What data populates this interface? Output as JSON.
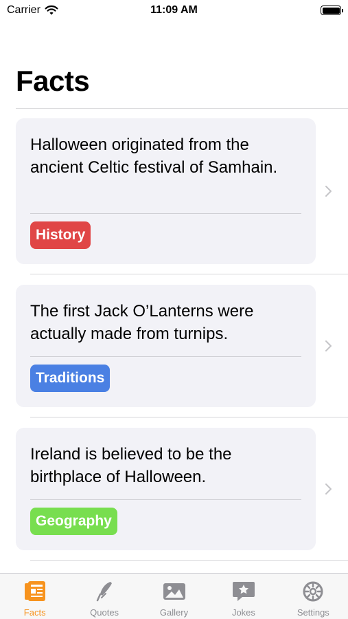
{
  "status_bar": {
    "carrier": "Carrier",
    "time": "11:09 AM"
  },
  "page": {
    "title": "Facts"
  },
  "facts": [
    {
      "text": "Halloween originated from the ancient Celtic festival of Samhain.",
      "tag": "History",
      "tag_color": "#e04646"
    },
    {
      "text": "The first Jack O’Lanterns were actually made from turnips.",
      "tag": "Traditions",
      "tag_color": "#4a80e3"
    },
    {
      "text": "Ireland is believed to be the birthplace of Halloween.",
      "tag": "Geography",
      "tag_color": "#78de4f"
    }
  ],
  "tab_bar": {
    "active": "Facts",
    "accent_color": "#f7931e",
    "tabs": [
      {
        "label": "Facts",
        "icon": "newspaper-icon"
      },
      {
        "label": "Quotes",
        "icon": "quill-pen-icon"
      },
      {
        "label": "Gallery",
        "icon": "photo-icon"
      },
      {
        "label": "Jokes",
        "icon": "star-bubble-icon"
      },
      {
        "label": "Settings",
        "icon": "gear-icon"
      }
    ]
  }
}
